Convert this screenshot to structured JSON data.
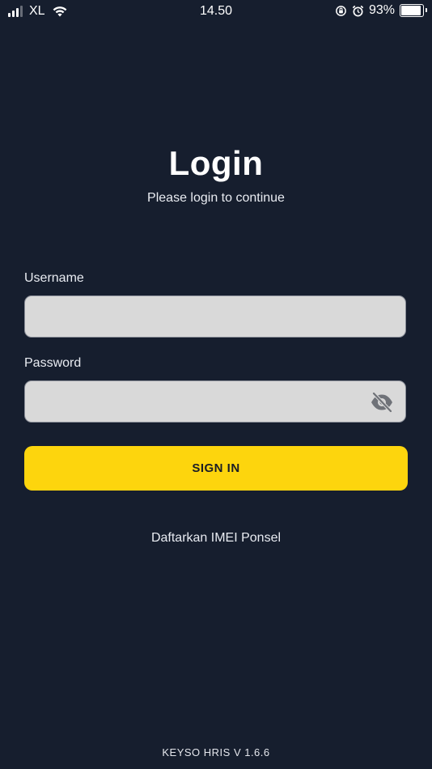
{
  "status_bar": {
    "carrier": "XL",
    "time": "14.50",
    "battery": "93%",
    "battery_level": 0.93,
    "icons": [
      "signal-icon",
      "wifi-icon",
      "orientation-lock-icon",
      "alarm-icon",
      "battery-icon"
    ]
  },
  "header": {
    "title": "Login",
    "subtitle": "Please login to continue"
  },
  "form": {
    "username_label": "Username",
    "username_value": "",
    "password_label": "Password",
    "password_value": "",
    "password_toggle_icon": "eye-off-icon",
    "submit_label": "SIGN IN"
  },
  "links": {
    "register_imei": "Daftarkan IMEI Ponsel"
  },
  "footer": {
    "version": "KEYSO HRIS V 1.6.6"
  },
  "colors": {
    "background": "#161e2e",
    "accent": "#fdd50d",
    "input_bg": "#d9d9d9"
  }
}
